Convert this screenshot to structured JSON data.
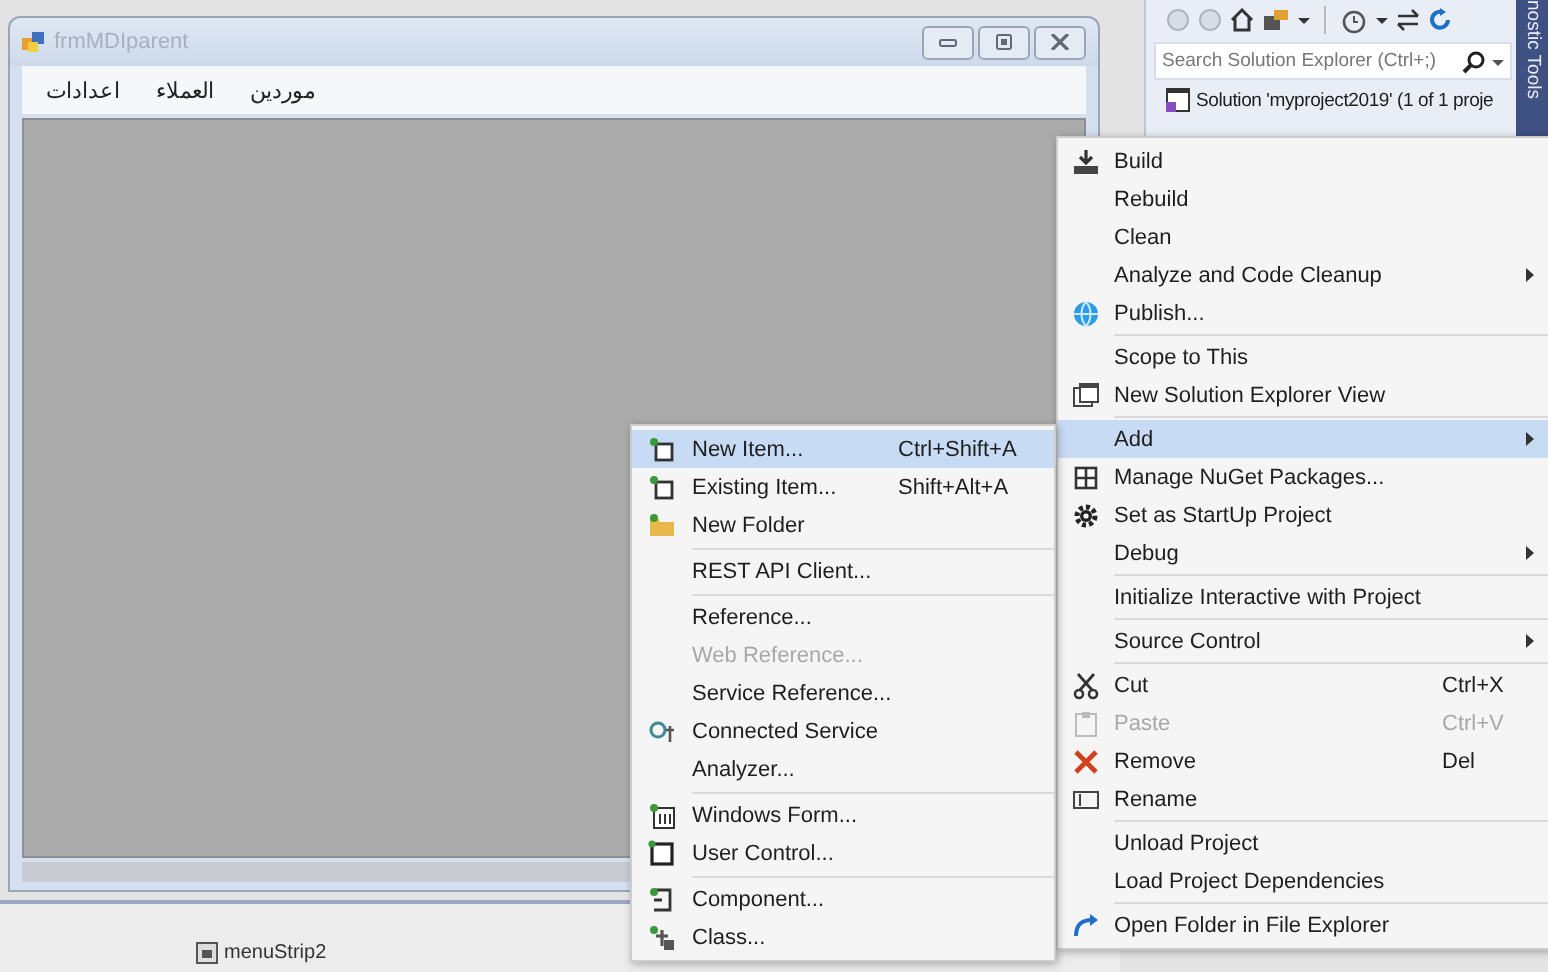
{
  "form": {
    "title": "frmMDIparent",
    "menu": [
      "موردين",
      "العملاء",
      "اعدادات"
    ]
  },
  "component_tray": {
    "items": [
      "menuStrip2"
    ]
  },
  "solution_explorer": {
    "search": {
      "placeholder": "Search Solution Explorer (Ctrl+;)"
    },
    "tree": [
      {
        "label": "Solution 'myproject2019' (1 of 1 proje"
      }
    ]
  },
  "side_tab": {
    "label": "nostic Tools"
  },
  "context_menu": {
    "groups": [
      [
        {
          "label": "Build",
          "submenu": false,
          "disabled": false,
          "selected": false
        },
        {
          "label": "Rebuild",
          "submenu": false,
          "disabled": false,
          "selected": false
        },
        {
          "label": "Clean",
          "submenu": false,
          "disabled": false,
          "selected": false
        },
        {
          "label": "Analyze and Code Cleanup",
          "submenu": true,
          "disabled": false,
          "selected": false
        },
        {
          "label": "Publish...",
          "submenu": false,
          "disabled": false,
          "selected": false
        }
      ],
      [
        {
          "label": "Scope to This",
          "submenu": false,
          "disabled": false,
          "selected": false
        },
        {
          "label": "New Solution Explorer View",
          "submenu": false,
          "disabled": false,
          "selected": false
        }
      ],
      [
        {
          "label": "Add",
          "submenu": true,
          "disabled": false,
          "selected": true
        },
        {
          "label": "Manage NuGet Packages...",
          "submenu": false,
          "disabled": false,
          "selected": false
        },
        {
          "label": "Set as StartUp Project",
          "submenu": false,
          "disabled": false,
          "selected": false
        },
        {
          "label": "Debug",
          "submenu": true,
          "disabled": false,
          "selected": false
        }
      ],
      [
        {
          "label": "Initialize Interactive with Project",
          "submenu": false,
          "disabled": false,
          "selected": false
        }
      ],
      [
        {
          "label": "Source Control",
          "submenu": true,
          "disabled": false,
          "selected": false
        }
      ],
      [
        {
          "label": "Cut",
          "shortcut": "Ctrl+X",
          "submenu": false,
          "disabled": false,
          "selected": false
        },
        {
          "label": "Paste",
          "shortcut": "Ctrl+V",
          "submenu": false,
          "disabled": true,
          "selected": false
        },
        {
          "label": "Remove",
          "shortcut": "Del",
          "submenu": false,
          "disabled": false,
          "selected": false
        },
        {
          "label": "Rename",
          "submenu": false,
          "disabled": false,
          "selected": false
        }
      ],
      [
        {
          "label": "Unload Project",
          "submenu": false,
          "disabled": false,
          "selected": false
        },
        {
          "label": "Load Project Dependencies",
          "submenu": false,
          "disabled": false,
          "selected": false
        }
      ],
      [
        {
          "label": "Open Folder in File Explorer",
          "submenu": false,
          "disabled": false,
          "selected": false
        }
      ]
    ]
  },
  "submenu": {
    "groups": [
      [
        {
          "label": "New Item...",
          "shortcut": "Ctrl+Shift+A",
          "disabled": false,
          "selected": true
        },
        {
          "label": "Existing Item...",
          "shortcut": "Shift+Alt+A",
          "disabled": false,
          "selected": false
        },
        {
          "label": "New Folder",
          "disabled": false,
          "selected": false
        }
      ],
      [
        {
          "label": "REST API Client...",
          "disabled": false,
          "selected": false
        }
      ],
      [
        {
          "label": "Reference...",
          "disabled": false,
          "selected": false
        },
        {
          "label": "Web Reference...",
          "disabled": true,
          "selected": false
        },
        {
          "label": "Service Reference...",
          "disabled": false,
          "selected": false
        },
        {
          "label": "Connected Service",
          "disabled": false,
          "selected": false
        },
        {
          "label": "Analyzer...",
          "disabled": false,
          "selected": false
        }
      ],
      [
        {
          "label": "Windows Form...",
          "disabled": false,
          "selected": false
        },
        {
          "label": "User Control...",
          "disabled": false,
          "selected": false
        }
      ],
      [
        {
          "label": "Component...",
          "disabled": false,
          "selected": false
        },
        {
          "label": "Class...",
          "disabled": false,
          "selected": false
        }
      ]
    ]
  }
}
